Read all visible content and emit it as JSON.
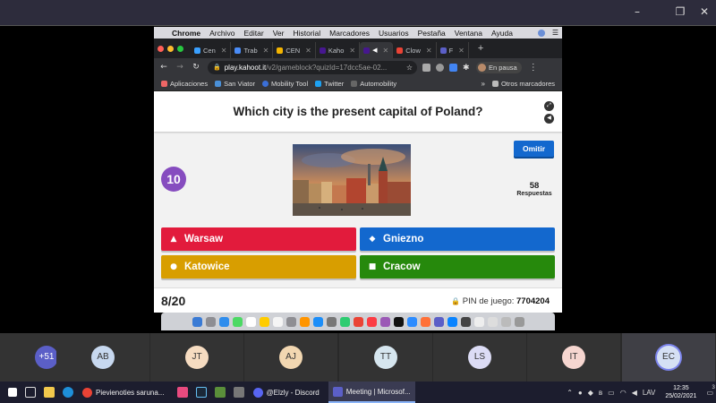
{
  "mac_menu": {
    "app": "Chrome",
    "items": [
      "Archivo",
      "Editar",
      "Ver",
      "Historial",
      "Marcadores",
      "Usuarios",
      "Pestaña",
      "Ventana",
      "Ayuda"
    ]
  },
  "chrome": {
    "tabs": [
      {
        "label": "Cen",
        "color": "#3aa0ff"
      },
      {
        "label": "Trab",
        "color": "#4a8cf7"
      },
      {
        "label": "CEN",
        "color": "#f4b400"
      },
      {
        "label": "Kaho",
        "color": "#46178f"
      },
      {
        "label": "",
        "color": "#46178f"
      },
      {
        "label": "Clow",
        "color": "#ea4335"
      },
      {
        "label": "F",
        "color": "#5b5fc7"
      }
    ],
    "url_host": "play.kahoot.it",
    "url_path": "/v2/gameblock?quizId=17dcc5ae-02...",
    "pause_label": "En pausa",
    "bookmarks": [
      {
        "label": "Aplicaciones",
        "color": "#e66"
      },
      {
        "label": "San Viator",
        "color": "#4a90d9"
      },
      {
        "label": "Mobility Tool",
        "color": "#3b6fd8"
      },
      {
        "label": "Twitter",
        "color": "#1da1f2"
      },
      {
        "label": "Automobility",
        "color": "#666"
      }
    ],
    "other_bookmarks": "Otros marcadores"
  },
  "kahoot": {
    "question": "Which city is the present capital of Poland?",
    "timer": "10",
    "skip_label": "Omitir",
    "answers_count": "58",
    "answers_label": "Respuestas",
    "answers": [
      {
        "label": "Warsaw",
        "shape": "▲",
        "color": "#e21b3c"
      },
      {
        "label": "Gniezno",
        "shape": "◆",
        "color": "#1368ce"
      },
      {
        "label": "Katowice",
        "shape": "●",
        "color": "#d89e00"
      },
      {
        "label": "Cracow",
        "shape": "■",
        "color": "#26890c"
      }
    ],
    "progress": "8/20",
    "pin_label": "PIN de juego:",
    "pin": "7704204"
  },
  "participants": [
    {
      "label": "+51",
      "color": "#5b5fc7",
      "text": "#ffffff"
    },
    {
      "label": "AB",
      "color": "#c7d8ef",
      "text": "#333333"
    },
    {
      "label": "JT",
      "color": "#f6dcc1",
      "text": "#333333"
    },
    {
      "label": "AJ",
      "color": "#f2d7b1",
      "text": "#333333"
    },
    {
      "label": "TT",
      "color": "#d6e6ef",
      "text": "#333333"
    },
    {
      "label": "LS",
      "color": "#dcdcf5",
      "text": "#333333"
    },
    {
      "label": "IT",
      "color": "#f6d6d0",
      "text": "#333333"
    },
    {
      "label": "EC",
      "color": "#d5e0f4",
      "text": "#333333"
    }
  ],
  "taskbar": {
    "apps": [
      {
        "label": "Pievienoties saruna...",
        "color": "#ea4335",
        "active": false
      },
      {
        "label": "@Elzly - Discord",
        "color": "#5865f2",
        "active": false
      },
      {
        "label": "Meeting | Microsof...",
        "color": "#5b5fc7",
        "active": true
      }
    ],
    "lang": "LAV",
    "time": "12:35",
    "date": "25/02/2021",
    "notifications": "3"
  }
}
